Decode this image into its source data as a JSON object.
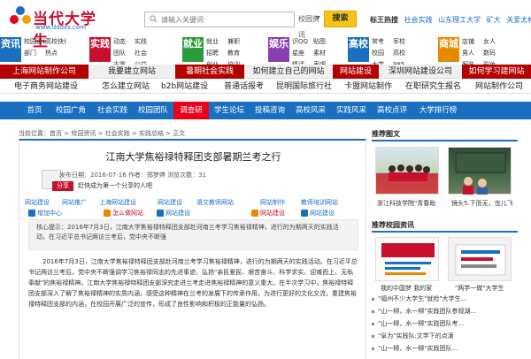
{
  "header": {
    "logo_title": "当代大学生",
    "logo_url": "www.dddxs.com",
    "search_placeholder": "请输入关键词",
    "search_scope": "校园资讯",
    "search_button": "搜索",
    "tag_label": "标王热搜",
    "tags": [
      "社会实践",
      "山东理工大学",
      "矿大",
      "关爱太格"
    ]
  },
  "categories": [
    {
      "tag": "资讯",
      "color": "#1a6fc1",
      "links": [
        "校园资讯",
        "高校快讯",
        "部门",
        "热点"
      ]
    },
    {
      "tag": "实践",
      "color": "#c8102e",
      "links": [
        "动态",
        "实践",
        "团队",
        "社会",
        "志愿",
        "公益"
      ]
    },
    {
      "tag": "就业",
      "color": "#2a9d3a",
      "links": [
        "就业",
        "",
        "兼职",
        "招聘",
        "教育",
        "",
        "创业",
        "培训"
      ]
    },
    {
      "tag": "娱乐",
      "color": "#8a3fb0",
      "links": [
        "识QQ",
        "贴图",
        "星座",
        "素材",
        "情话",
        "雅乐",
        "",
        "表吧"
      ]
    },
    {
      "tag": "高校",
      "color": "#1a6fc1",
      "links": [
        "常考",
        "军校",
        "校园",
        "高校",
        "新闻",
        "大学",
        "985",
        "院校"
      ]
    },
    {
      "tag": "商城",
      "color": "#e88a00",
      "links": [
        "店铺",
        "女人",
        "男人",
        "数码",
        "资讯",
        "服装",
        "彩妆",
        "数码"
      ]
    }
  ],
  "red_bar_1": [
    "上海网站制作公司",
    "我要建立网站",
    "暑期社会实践",
    "如何建立自己的网站",
    "网站建设",
    "深圳网站建设公司",
    "如何学习建网站"
  ],
  "grey_bar": [
    "电子商务网站建设",
    "怎么建立网站",
    "b2b网站建设",
    "普通话报考",
    "昆明国际旅行社",
    "卡盟网站制作",
    "在职研究生报名",
    "网站制作公司"
  ],
  "nav": [
    "首页",
    "校园广角",
    "社会实践",
    "校园团队",
    "调查研",
    "学生论坛",
    "投稿咨询",
    "高校风采",
    "实践风采",
    "高校点评",
    "大学排行榜"
  ],
  "breadcrumb": "当前位置：首页 > 校园资讯 > 社会实践 > 实践总结 > 正文",
  "article": {
    "title": "江南大学焦裕禄特释团支部暑期兰考之行",
    "meta": "发布日期：2016-07-16  作者：郑梦婷  浏览次数：31",
    "share": "分享",
    "share_note": "赶快成为第一个分享的人吧",
    "toolbar_1": [
      "网站建设",
      "网站推广",
      "上海网站建设",
      "网站建设",
      "语文教师网站",
      "网站制作",
      "教师培训网站"
    ],
    "toolbar_2": [
      "增加中心",
      "",
      "怎么做网站",
      "网站建设",
      "",
      "网站建设",
      "网站建设"
    ],
    "summary": "核心提示：2016年7月3日，江南大学焦裕禄特释团支部赴河南兰考学习焦裕禄精神，进行的为期两天的实践活动，在习近平总书记两访兰考后，党中央不断强",
    "body": "2016年7月3日，江南大学焦裕禄特释团支部赴河南兰考学习焦裕禄精神，进行的为期两天的实践活动。在习近平总书记两访兰考后，党中央不断强调学习焦裕禄同志的先进事迹，弘扬\"亲民爱民、艰苦奋斗、科学求实、迎难而上、无私奉献\"的焦裕禄精神。江南大学焦裕禄特释团支部深究走进兰考走进焦裕禄精神的意义重大。在半次学习中，焦裕禄特释团支部深入了解了焦裕禄精神的实质内涵，感受这种精神在兰考的发展下的传承作用，为进行更好的文化交流，重建焦裕禄特释团支部的内涵，在校园开展广泛的宣传，形成了良性影响和积极的正能量的弘扬。"
  },
  "sidebar": {
    "title_1": "推荐图文",
    "captions_1": [
      "浙江科技学院\"青春助",
      "镜头5.下而无，虫儿飞"
    ],
    "title_2": "推荐校园资讯",
    "captions_2": [
      "我的中国梦 我的家",
      "\"两学一做\"大学生"
    ],
    "list": [
      "\"福州不少大学生\"就检\"大学生...",
      "\"山一柳，水一柳\"实践团队参观湖...",
      "\"山一柳，水一柳\"实践团队考...",
      "\"阜为\"实践队:文学下的点滴",
      "\"山一柳，水一柳\"实践团队..."
    ]
  }
}
